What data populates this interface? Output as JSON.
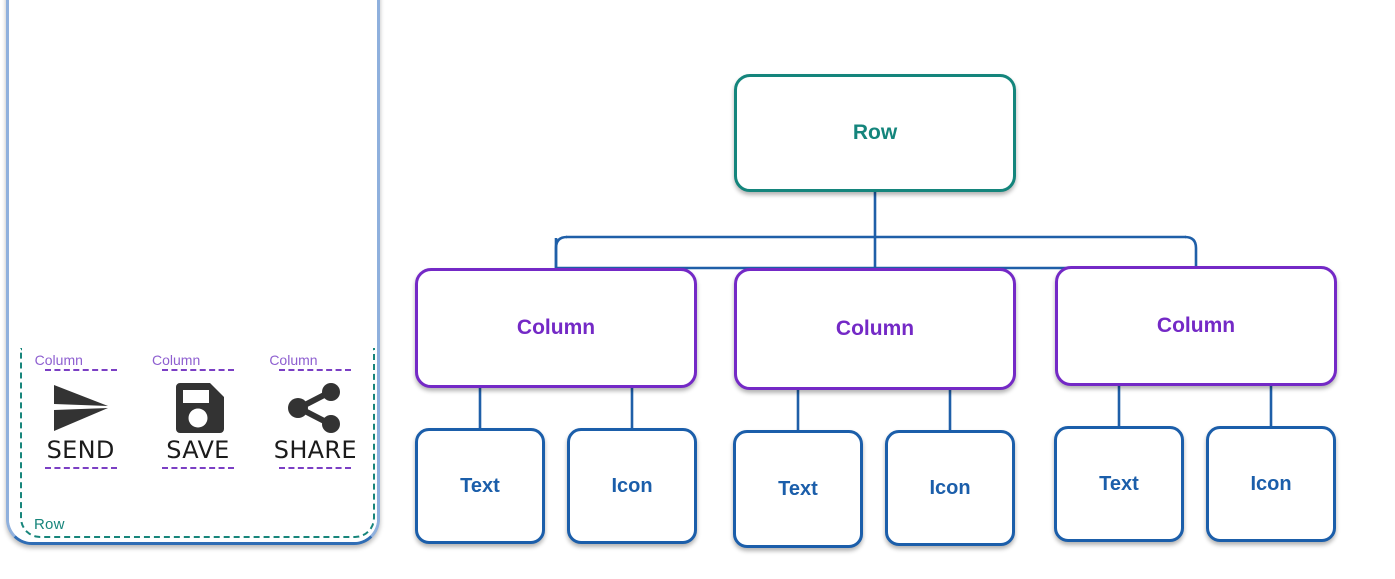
{
  "device": {
    "name": "phone-mockup",
    "row_overlay_label": "Row",
    "columns": [
      {
        "tag": "Column",
        "icon": "send-icon",
        "label": "SEND"
      },
      {
        "tag": "Column",
        "icon": "save-icon",
        "label": "SAVE"
      },
      {
        "tag": "Column",
        "icon": "share-icon",
        "label": "SHARE"
      }
    ]
  },
  "tree": {
    "root": {
      "label": "Row"
    },
    "columns": [
      {
        "label": "Column",
        "children": [
          {
            "label": "Text"
          },
          {
            "label": "Icon"
          }
        ]
      },
      {
        "label": "Column",
        "children": [
          {
            "label": "Text"
          },
          {
            "label": "Icon"
          }
        ]
      },
      {
        "label": "Column",
        "children": [
          {
            "label": "Text"
          },
          {
            "label": "Icon"
          }
        ]
      }
    ]
  },
  "colors": {
    "row_teal": "#14857c",
    "column_purple": "#7429c6",
    "leaf_blue": "#1b5eaa",
    "edge_blue": "#1f5fa8",
    "device_frame_blue": "#2f6db5",
    "dashed_teal": "#17857b",
    "dashed_purple": "#7b3fc4",
    "icon_dark": "#333333"
  }
}
